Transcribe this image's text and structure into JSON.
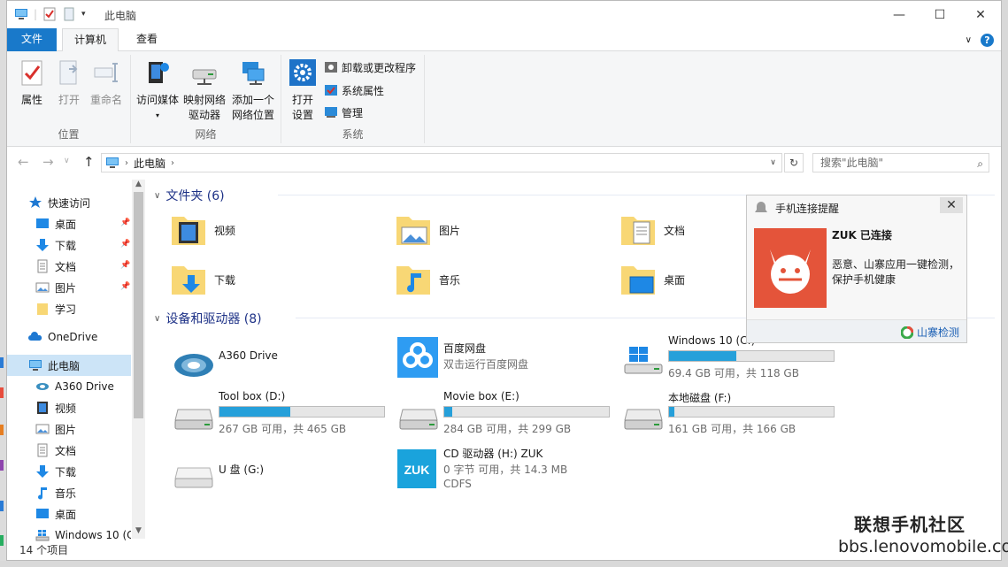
{
  "titlebar": {
    "title": "此电脑",
    "minimize": "—",
    "maximize": "☐",
    "close": "✕"
  },
  "tabs": {
    "file": "文件",
    "computer": "计算机",
    "view": "查看",
    "collapse": "∨"
  },
  "ribbon": {
    "location": {
      "label": "位置",
      "properties": "属性",
      "open": "打开",
      "rename": "重命名"
    },
    "network": {
      "label": "网络",
      "media": "访问媒体",
      "map_drive_1": "映射网络",
      "map_drive_2": "驱动器",
      "add_location_1": "添加一个",
      "add_location_2": "网络位置"
    },
    "system": {
      "label": "系统",
      "open_settings_1": "打开",
      "open_settings_2": "设置",
      "uninstall": "卸载或更改程序",
      "sys_props": "系统属性",
      "manage": "管理"
    }
  },
  "addressbar": {
    "path": "此电脑",
    "search_placeholder": "搜索\"此电脑\""
  },
  "navpane": {
    "items": [
      {
        "label": "快速访问",
        "icon": "star-icon"
      },
      {
        "label": "桌面",
        "icon": "desktop-icon",
        "pinned": true
      },
      {
        "label": "下载",
        "icon": "download-icon",
        "pinned": true
      },
      {
        "label": "文档",
        "icon": "document-icon",
        "pinned": true
      },
      {
        "label": "图片",
        "icon": "picture-icon",
        "pinned": true
      },
      {
        "label": "学习",
        "icon": "folder-icon"
      },
      {
        "label": "OneDrive",
        "icon": "cloud-icon"
      },
      {
        "label": "此电脑",
        "icon": "computer-icon",
        "selected": true
      },
      {
        "label": "A360 Drive",
        "icon": "a360-icon"
      },
      {
        "label": "视频",
        "icon": "video-icon"
      },
      {
        "label": "图片",
        "icon": "picture-icon"
      },
      {
        "label": "文档",
        "icon": "document-icon"
      },
      {
        "label": "下载",
        "icon": "download-icon"
      },
      {
        "label": "音乐",
        "icon": "music-icon"
      },
      {
        "label": "桌面",
        "icon": "desktop-icon"
      },
      {
        "label": "Windows 10 (C",
        "icon": "windows-drive-icon"
      }
    ]
  },
  "content": {
    "folders_header": "文件夹 (6)",
    "folders": [
      {
        "label": "视频",
        "icon": "video-folder-icon"
      },
      {
        "label": "图片",
        "icon": "picture-folder-icon"
      },
      {
        "label": "文档",
        "icon": "document-folder-icon"
      },
      {
        "label": "下载",
        "icon": "download-folder-icon"
      },
      {
        "label": "音乐",
        "icon": "music-folder-icon"
      },
      {
        "label": "桌面",
        "icon": "desktop-folder-icon"
      }
    ],
    "devices_header": "设备和驱动器 (8)",
    "drives": [
      {
        "name": "A360 Drive",
        "icon": "a360-icon"
      },
      {
        "name": "百度网盘",
        "sub": "双击运行百度网盘",
        "icon": "baidu-cloud-icon"
      },
      {
        "name": "Windows 10 (C:)",
        "sub": "69.4 GB 可用，共 118 GB",
        "used": 0.41,
        "icon": "windows-drive-icon"
      },
      {
        "name": "Tool box (D:)",
        "sub": "267 GB 可用，共 465 GB",
        "used": 0.43,
        "icon": "hdd-icon"
      },
      {
        "name": "Movie box (E:)",
        "sub": "284 GB 可用，共 299 GB",
        "used": 0.05,
        "icon": "hdd-icon"
      },
      {
        "name": "本地磁盘 (F:)",
        "sub": "161 GB 可用，共 166 GB",
        "used": 0.03,
        "icon": "hdd-icon"
      },
      {
        "name": "U 盘 (G:)",
        "icon": "usb-drive-icon"
      },
      {
        "name": "CD 驱动器 (H:) ZUK",
        "sub": "0 字节 可用，共 14.3 MB",
        "sub2": "CDFS",
        "icon": "zuk-icon"
      }
    ]
  },
  "status": {
    "count": "14 个项目"
  },
  "popup": {
    "title": "手机连接提醒",
    "heading": "ZUK 已连接",
    "body": "恶意、山寨应用一键检测，保护手机健康",
    "link": "山寨检测"
  },
  "watermark": {
    "line1": "联想手机社区",
    "line2": "bbs.lenovomobile.com"
  },
  "colors": {
    "accent": "#1979ca",
    "bar_fill": "#26a0da",
    "popup_icon": "#e4543a",
    "folder": "#f8d775"
  }
}
